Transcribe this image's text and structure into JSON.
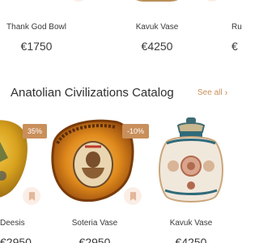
{
  "top_row": [
    {
      "name": "Thank God Bowl",
      "price": "€1750"
    },
    {
      "name": "Kavuk Vase",
      "price": "€4250"
    },
    {
      "name": "Ru",
      "price": "€"
    }
  ],
  "section": {
    "title": "Anatolian Civilizations Catalog",
    "see_all": "See all",
    "see_all_chevron": "›"
  },
  "products": [
    {
      "name": "Deesis",
      "price": "€2950",
      "discount": "35%"
    },
    {
      "name": "Soteria Vase",
      "price": "€2950",
      "discount": "-10%"
    },
    {
      "name": "Kavuk Vase",
      "price": "€4250",
      "discount": ""
    }
  ],
  "colors": {
    "accent": "#c98f5a",
    "bookmark_bg": "#fbeee6",
    "text": "#333333"
  },
  "icons": {
    "bookmark": "bookmark-icon",
    "see_all": "chevron-right-icon"
  }
}
